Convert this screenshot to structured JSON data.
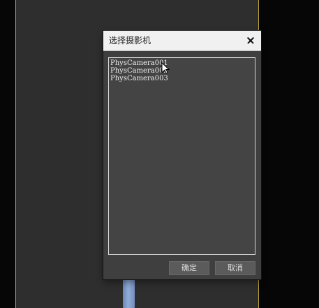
{
  "dialog": {
    "title": "选择摄影机",
    "items": [
      "PhysCamera001",
      "PhysCamera002",
      "PhysCamera003"
    ],
    "ok_label": "确定",
    "cancel_label": "取消"
  },
  "icons": {
    "close": "close-icon",
    "cursor": "arrow-cursor-icon"
  },
  "colors": {
    "background": "#060606",
    "viewport": "#2e2e2e",
    "viewport_border": "#b9a23a",
    "dialog_bg": "#3f3f3f",
    "titlebar_bg": "#f0f0f0",
    "list_bg": "#444444",
    "list_border": "#d9d9d9",
    "button_bg": "#5b5b5b",
    "text_light": "#f0f0f0"
  }
}
